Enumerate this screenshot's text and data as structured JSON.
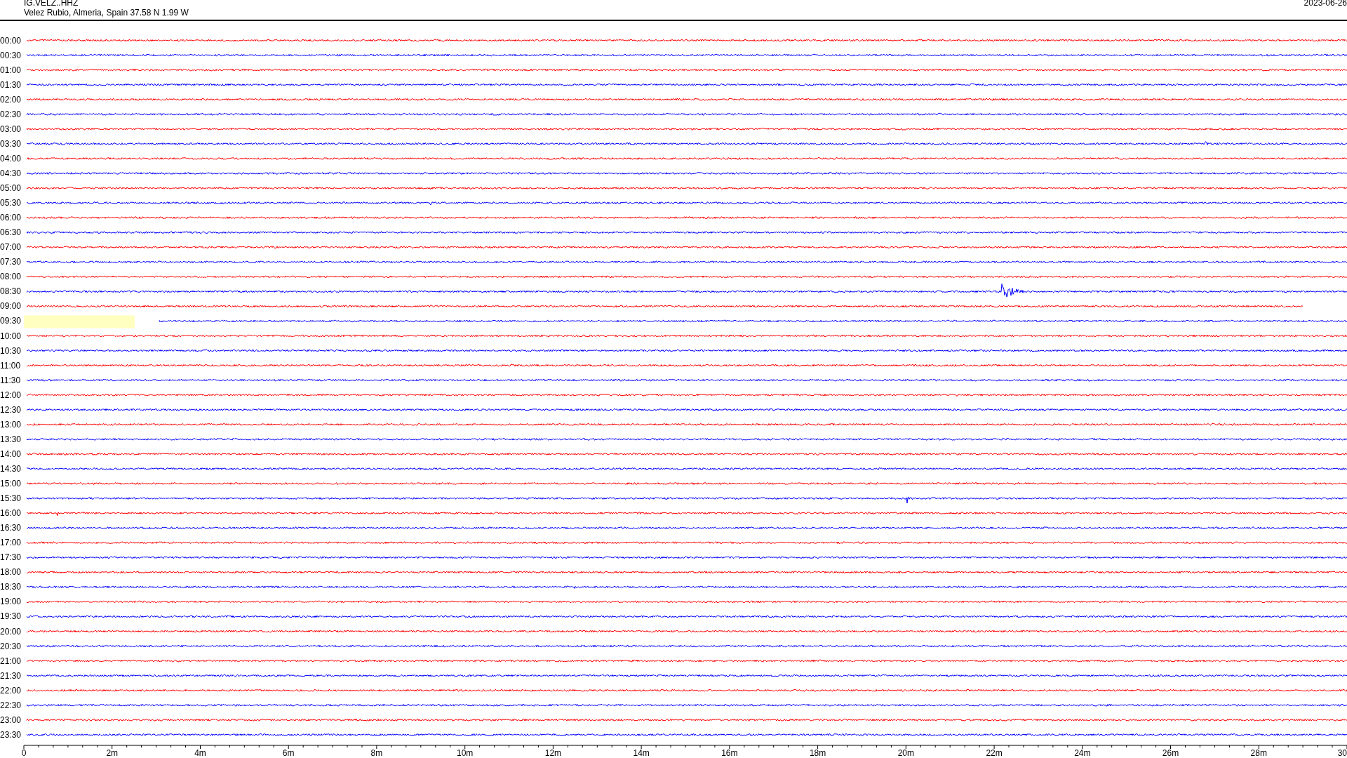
{
  "header": {
    "station": "IG.VELZ..HHZ",
    "location": "Velez Rubio, Almeria, Spain  37.58 N 1.99 W",
    "date": "2023-06-26"
  },
  "rows": [
    {
      "time": "00:00",
      "color": "#ff0000"
    },
    {
      "time": "00:30",
      "color": "#0000ff"
    },
    {
      "time": "01:00",
      "color": "#ff0000"
    },
    {
      "time": "01:30",
      "color": "#0000ff"
    },
    {
      "time": "02:00",
      "color": "#ff0000"
    },
    {
      "time": "02:30",
      "color": "#0000ff"
    },
    {
      "time": "03:00",
      "color": "#ff0000"
    },
    {
      "time": "03:30",
      "color": "#0000ff"
    },
    {
      "time": "04:00",
      "color": "#ff0000"
    },
    {
      "time": "04:30",
      "color": "#0000ff"
    },
    {
      "time": "05:00",
      "color": "#ff0000"
    },
    {
      "time": "05:30",
      "color": "#0000ff"
    },
    {
      "time": "06:00",
      "color": "#ff0000"
    },
    {
      "time": "06:30",
      "color": "#0000ff"
    },
    {
      "time": "07:00",
      "color": "#ff0000"
    },
    {
      "time": "07:30",
      "color": "#0000ff"
    },
    {
      "time": "08:00",
      "color": "#ff0000"
    },
    {
      "time": "08:30",
      "color": "#0000ff"
    },
    {
      "time": "09:00",
      "color": "#ff0000"
    },
    {
      "time": "09:30",
      "color": "#0000ff"
    },
    {
      "time": "10:00",
      "color": "#ff0000"
    },
    {
      "time": "10:30",
      "color": "#0000ff"
    },
    {
      "time": "11:00",
      "color": "#ff0000"
    },
    {
      "time": "11:30",
      "color": "#0000ff"
    },
    {
      "time": "12:00",
      "color": "#ff0000"
    },
    {
      "time": "12:30",
      "color": "#0000ff"
    },
    {
      "time": "13:00",
      "color": "#ff0000"
    },
    {
      "time": "13:30",
      "color": "#0000ff"
    },
    {
      "time": "14:00",
      "color": "#ff0000"
    },
    {
      "time": "14:30",
      "color": "#0000ff"
    },
    {
      "time": "15:00",
      "color": "#ff0000"
    },
    {
      "time": "15:30",
      "color": "#0000ff"
    },
    {
      "time": "16:00",
      "color": "#ff0000"
    },
    {
      "time": "16:30",
      "color": "#0000ff"
    },
    {
      "time": "17:00",
      "color": "#ff0000"
    },
    {
      "time": "17:30",
      "color": "#0000ff"
    },
    {
      "time": "18:00",
      "color": "#ff0000"
    },
    {
      "time": "18:30",
      "color": "#0000ff"
    },
    {
      "time": "19:00",
      "color": "#ff0000"
    },
    {
      "time": "19:30",
      "color": "#0000ff"
    },
    {
      "time": "20:00",
      "color": "#ff0000"
    },
    {
      "time": "20:30",
      "color": "#0000ff"
    },
    {
      "time": "21:00",
      "color": "#ff0000"
    },
    {
      "time": "21:30",
      "color": "#0000ff"
    },
    {
      "time": "22:00",
      "color": "#ff0000"
    },
    {
      "time": "22:30",
      "color": "#0000ff"
    },
    {
      "time": "23:00",
      "color": "#ff0000"
    },
    {
      "time": "23:30",
      "color": "#0000ff"
    }
  ],
  "x_axis": {
    "ticks": [
      "0",
      "2m",
      "4m",
      "6m",
      "8m",
      "10m",
      "12m",
      "14m",
      "16m",
      "18m",
      "20m",
      "22m",
      "24m",
      "26m",
      "28m",
      "30"
    ]
  }
}
